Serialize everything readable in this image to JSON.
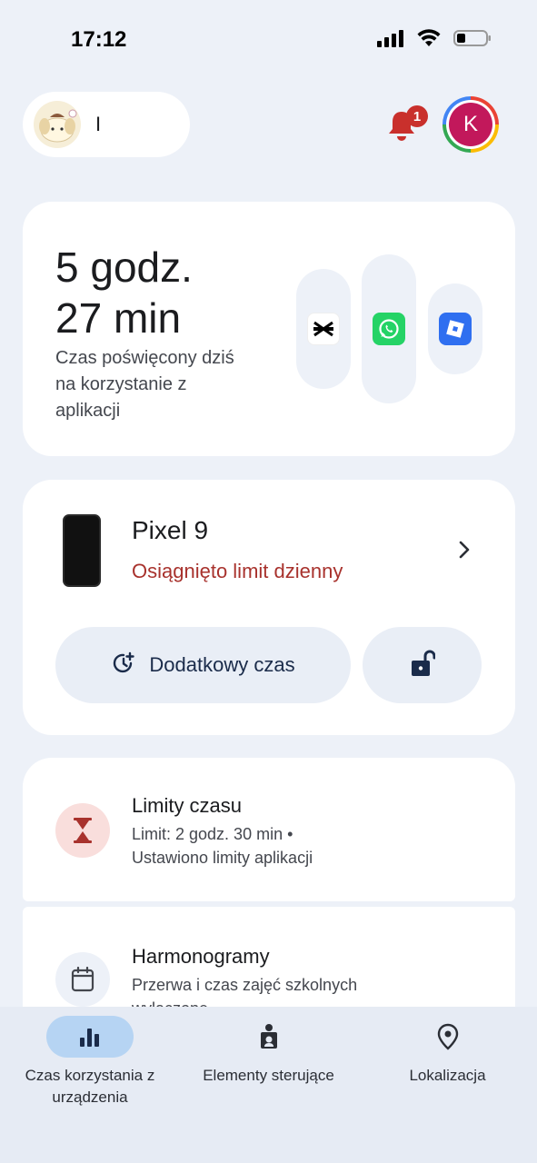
{
  "status_bar": {
    "time": "17:12"
  },
  "header": {
    "profile_name": "I",
    "notifications_count": "1",
    "account_initial": "K"
  },
  "usage": {
    "hours": "5 godz.",
    "minutes": "27 min",
    "description": "Czas poświęcony dziś na korzystanie z aplikacji",
    "apps": [
      "capcut-icon",
      "whatsapp-icon",
      "roblox-icon"
    ]
  },
  "device": {
    "name": "Pixel 9",
    "status": "Osiągnięto limit dzienny",
    "extra_time_label": "Dodatkowy czas"
  },
  "limits": {
    "title": "Limity czasu",
    "subtitle_line1": "Limit: 2 godz. 30 min •",
    "subtitle_line2": "Ustawiono limity aplikacji"
  },
  "schedules": {
    "title": "Harmonogramy",
    "subtitle_line1": "Przerwa i czas zajęć szkolnych",
    "subtitle_line2": "wyłączone"
  },
  "nav": {
    "items": [
      {
        "label": "Czas korzystania z urządzenia",
        "icon": "bar-chart-icon",
        "active": true
      },
      {
        "label": "Elementy sterujące",
        "icon": "parental-controls-icon",
        "active": false
      },
      {
        "label": "Lokalizacja",
        "icon": "location-pin-icon",
        "active": false
      }
    ]
  },
  "colors": {
    "background": "#edf1f8",
    "limit_reached": "#a8322d",
    "nav_active_pill": "#b6d4f3",
    "notification_badge": "#c9302c",
    "hourglass": "#a8322d"
  }
}
